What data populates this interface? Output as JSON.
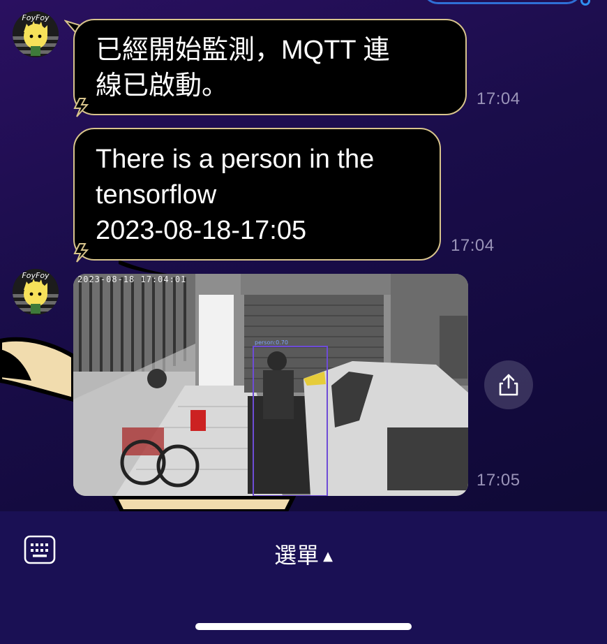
{
  "chat": {
    "messages": [
      {
        "lines": [
          "已經開始監測，MQTT 連",
          "線已啟動。"
        ],
        "time": "17:04"
      },
      {
        "lines": [
          "There is a person in the",
          "tensorflow",
          "2023-08-18-17:05"
        ],
        "time": "17:04"
      },
      {
        "image": {
          "timestamp_overlay": "2023-08-18 17:04:01",
          "detection_label": "person:0.70"
        },
        "time": "17:05"
      }
    ],
    "avatar_text": "FoyFoy"
  },
  "bottom_bar": {
    "menu_label": "選單",
    "menu_arrow": "▲"
  },
  "icons": {
    "keyboard": "keyboard-icon",
    "share": "share-icon"
  },
  "colors": {
    "bubble_bg": "#000000",
    "bubble_border": "#d8c48c",
    "bar_bg": "#1a1054",
    "time": "#9a94b8"
  }
}
